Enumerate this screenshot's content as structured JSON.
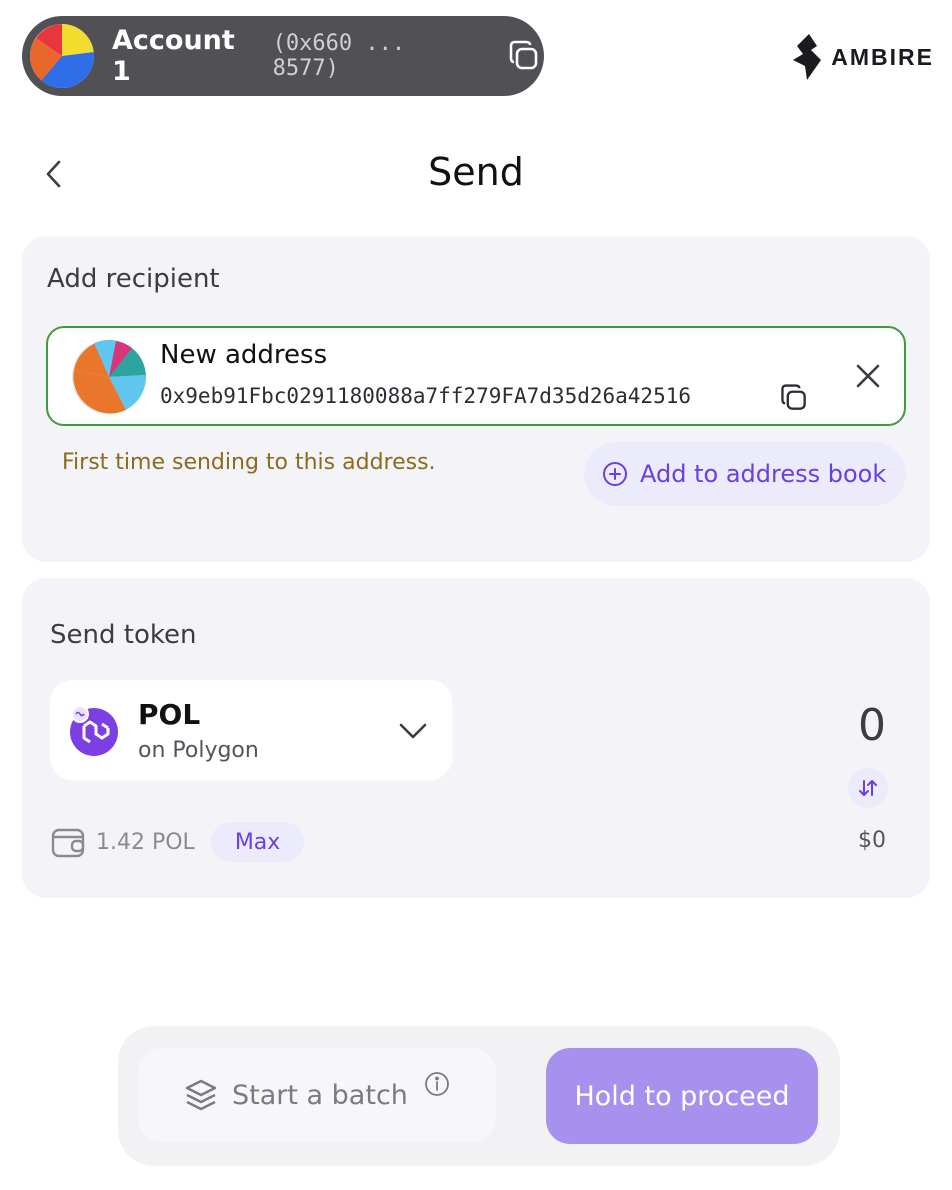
{
  "header": {
    "account_name": "Account 1",
    "account_address": "(0x660 ... 8577)",
    "brand": "AMBIRE"
  },
  "page": {
    "title": "Send"
  },
  "recipient": {
    "section_label": "Add recipient",
    "address_title": "New address",
    "address": "0x9eb91Fbc0291180088a7ff279FA7d35d26a42516",
    "warning": "First time sending to this address.",
    "add_book_label": "Add to address book"
  },
  "token": {
    "section_label": "Send token",
    "symbol": "POL",
    "network": "on Polygon",
    "amount": "0",
    "balance": "1.42 POL",
    "max_label": "Max",
    "usd_value": "$0"
  },
  "footer": {
    "batch_label": "Start a batch",
    "proceed_label": "Hold to proceed"
  },
  "colors": {
    "accent": "#6a3fe0",
    "proceed_bg": "#a791ee",
    "valid_border": "#3e9a3e",
    "warning_text": "#8c6a1e",
    "header_bg": "#505055"
  }
}
